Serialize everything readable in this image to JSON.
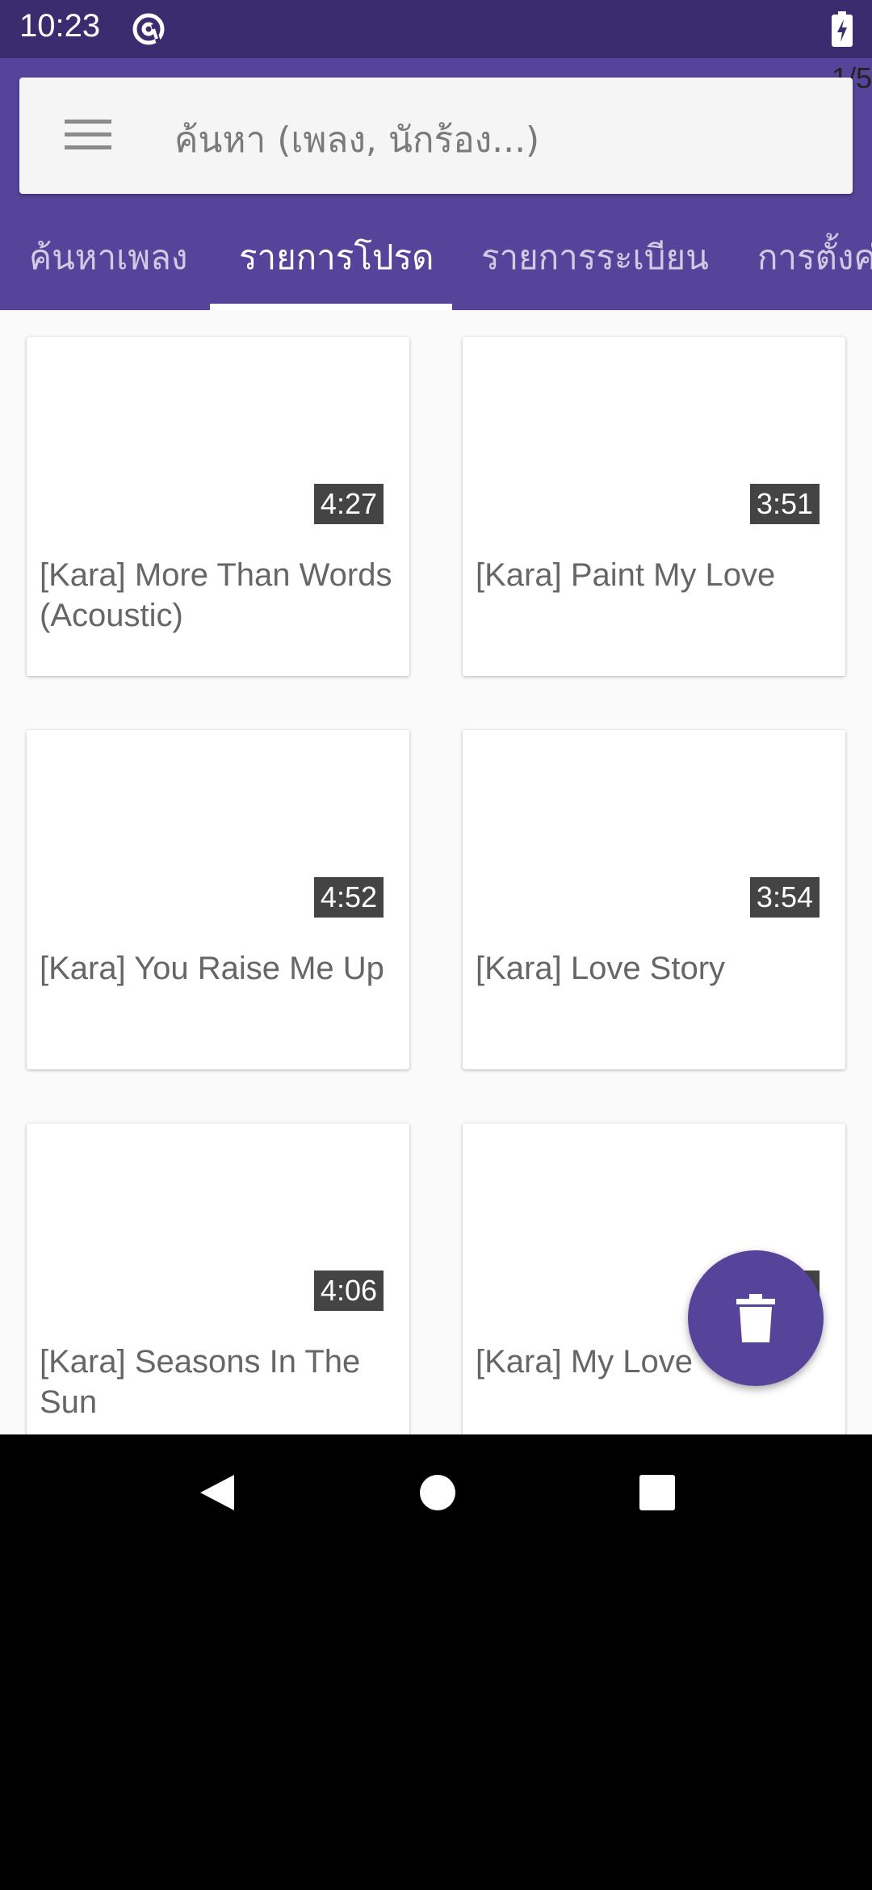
{
  "status_bar": {
    "time": "10:23",
    "sync_icon": "at-sync-icon",
    "battery_icon": "battery-charging-icon"
  },
  "page_indicator": "1/5",
  "search": {
    "placeholder": "ค้นหา (เพลง, นักร้อง...)"
  },
  "tabs": [
    {
      "label": "ค้นหาเพลง",
      "active": false
    },
    {
      "label": "รายการโปรด",
      "active": true
    },
    {
      "label": "รายการระเบียน",
      "active": false
    },
    {
      "label": "การตั้งค่",
      "active": false
    }
  ],
  "songs": [
    {
      "title": "[Kara] More Than Words (Acoustic)",
      "duration": "4:27"
    },
    {
      "title": "[Kara] Paint My Love",
      "duration": "3:51"
    },
    {
      "title": "[Kara] You Raise Me Up",
      "duration": "4:52"
    },
    {
      "title": "[Kara] Love Story",
      "duration": "3:54"
    },
    {
      "title": "[Kara] Seasons In The Sun",
      "duration": "4:06"
    },
    {
      "title": "[Kara] My Love",
      "duration": ""
    }
  ],
  "fab": {
    "icon": "trash-icon"
  },
  "nav": {
    "back_icon": "back-icon",
    "home_icon": "home-icon",
    "recents_icon": "recents-icon"
  },
  "colors": {
    "primary": "#55449a",
    "status_bar": "#3a2c6e",
    "background": "#fafafa"
  }
}
